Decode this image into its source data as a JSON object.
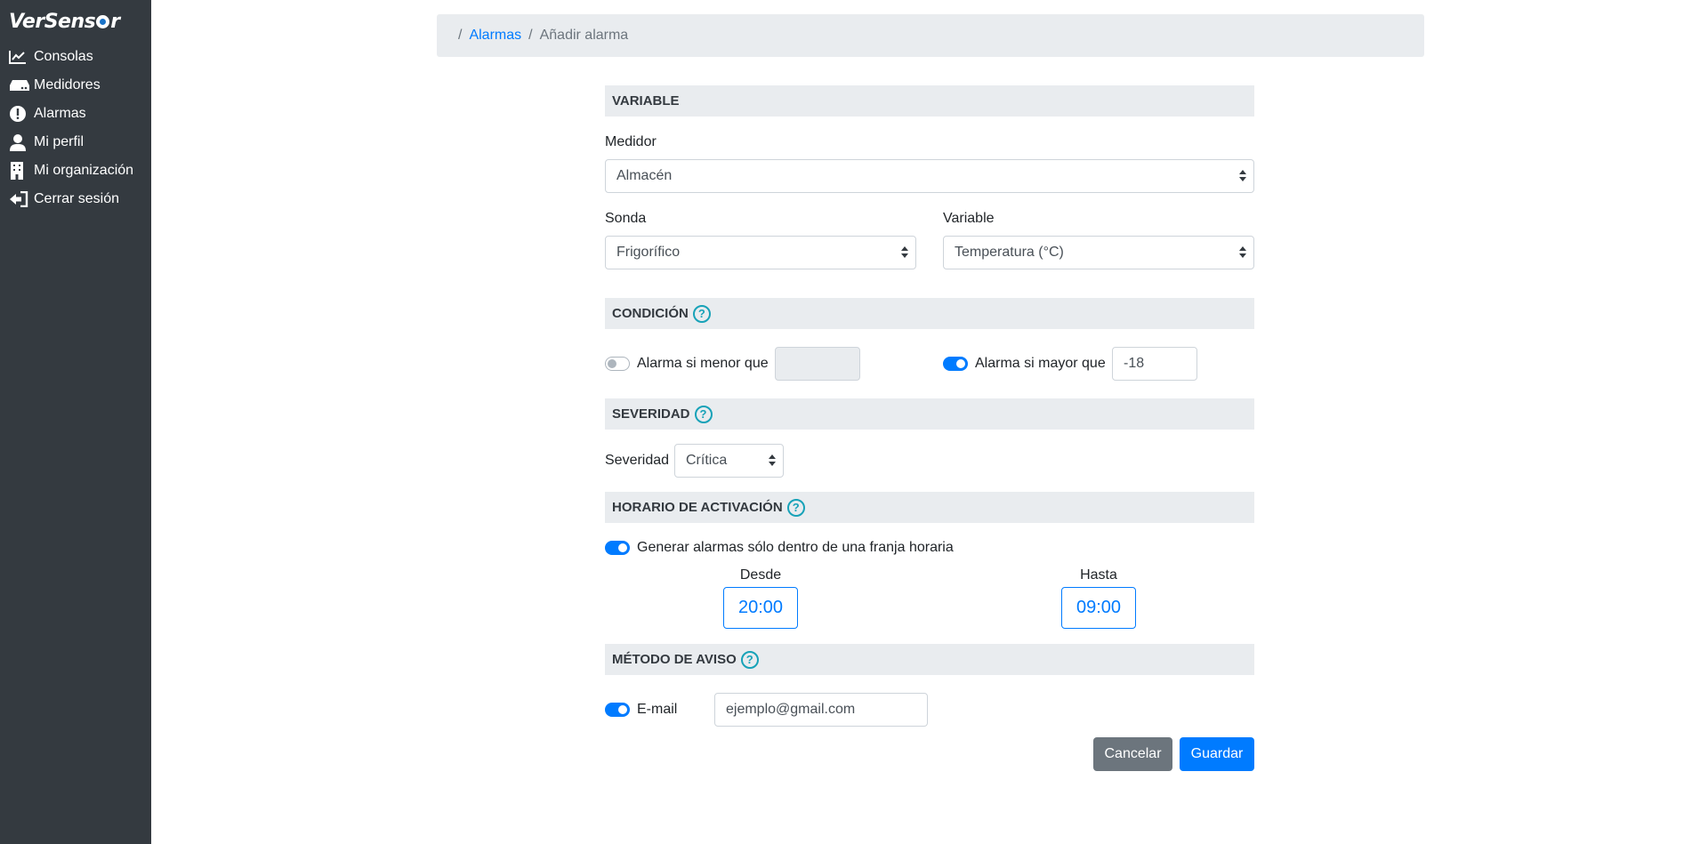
{
  "app": {
    "brand_left": "VerSens",
    "brand_right": "r"
  },
  "sidebar": {
    "items": [
      {
        "label": "Consolas",
        "icon": "chart-line-icon"
      },
      {
        "label": "Medidores",
        "icon": "hdd-icon"
      },
      {
        "label": "Alarmas",
        "icon": "exclamation-circle-icon"
      },
      {
        "label": "Mi perfil",
        "icon": "user-icon"
      },
      {
        "label": "Mi organización",
        "icon": "building-icon"
      },
      {
        "label": "Cerrar sesión",
        "icon": "sign-out-icon"
      }
    ]
  },
  "breadcrumb": {
    "sep": "/",
    "link": "Alarmas",
    "current": "Añadir alarma"
  },
  "sections": {
    "variable": "VARIABLE",
    "condicion": "CONDICIÓN",
    "severidad": "SEVERIDAD",
    "horario": "HORARIO DE ACTIVACIÓN",
    "metodo": "MÉTODO DE AVISO",
    "help_glyph": "?"
  },
  "form": {
    "medidor_label": "Medidor",
    "medidor_value": "Almacén",
    "sonda_label": "Sonda",
    "sonda_value": "Frigorífico",
    "variable_label": "Variable",
    "variable_value": "Temperatura (°C)",
    "menor_label": "Alarma si menor que",
    "menor_value": "",
    "menor_enabled": false,
    "mayor_label": "Alarma si mayor que",
    "mayor_value": "-18",
    "mayor_enabled": true,
    "severidad_label": "Severidad",
    "severidad_value": "Crítica",
    "franja_label": "Generar alarmas sólo dentro de una franja horaria",
    "franja_enabled": true,
    "desde_label": "Desde",
    "desde_value": "20:00",
    "hasta_label": "Hasta",
    "hasta_value": "09:00",
    "email_label": "E-mail",
    "email_value": "ejemplo@gmail.com",
    "email_enabled": true
  },
  "buttons": {
    "cancel": "Cancelar",
    "save": "Guardar"
  },
  "colors": {
    "sidebar_bg": "#343a40",
    "primary": "#007bff",
    "secondary": "#6c757d",
    "info": "#17a2b8",
    "section_bg": "#e9ecef"
  }
}
